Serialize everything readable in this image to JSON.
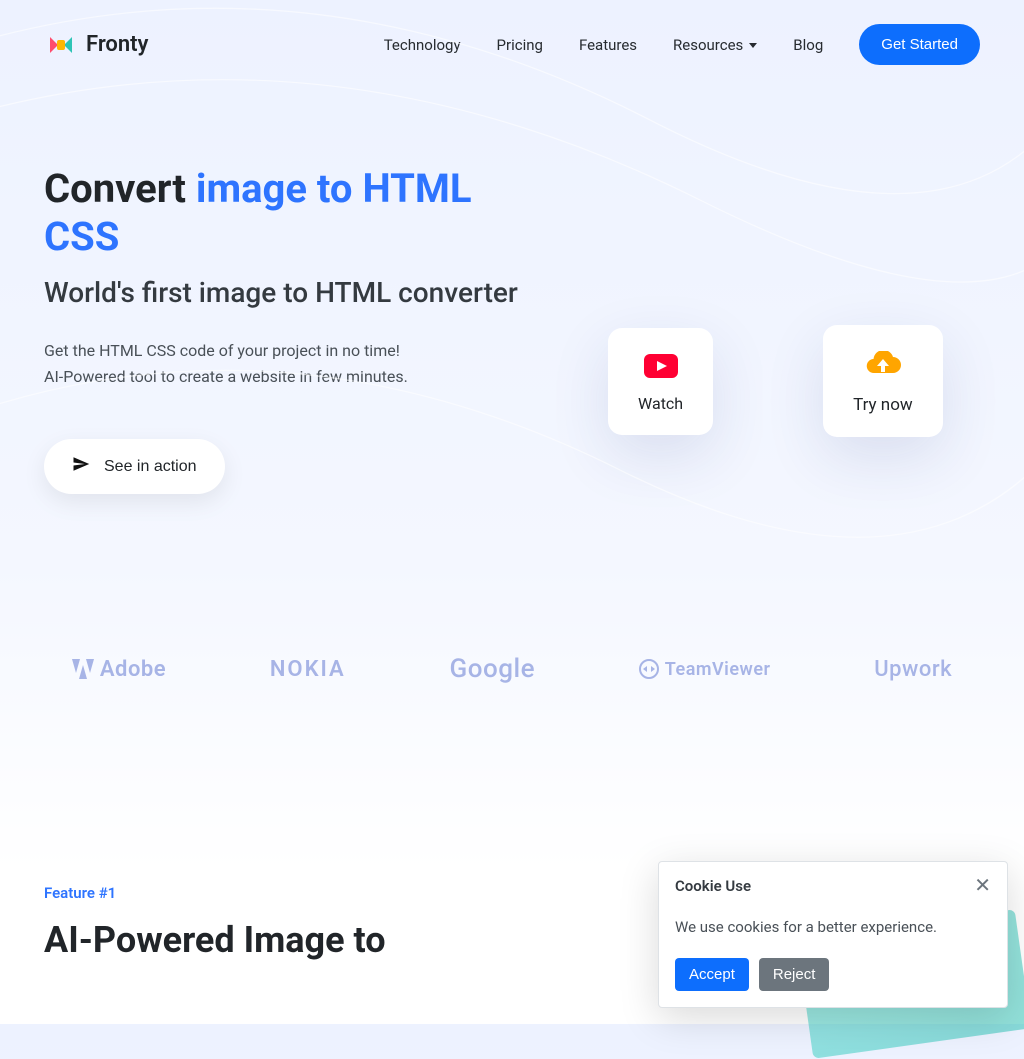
{
  "brand": {
    "name": "Fronty"
  },
  "nav": {
    "items": [
      "Technology",
      "Pricing",
      "Features",
      "Resources",
      "Blog"
    ],
    "cta": "Get Started"
  },
  "hero": {
    "title_prefix": "Convert ",
    "title_highlight": "image to HTML CSS",
    "subtitle": "World's first image to HTML converter",
    "desc_line1": "Get the HTML CSS code of your project in no time!",
    "desc_line2": "AI-Powered tool to create a website in few minutes.",
    "action_button": "See in action",
    "card_watch": "Watch",
    "card_try": "Try now"
  },
  "logos": [
    "Adobe",
    "NOKIA",
    "Google",
    "TeamViewer",
    "Upwork"
  ],
  "feature": {
    "tag": "Feature #1",
    "title": "AI-Powered Image to"
  },
  "cookie": {
    "title": "Cookie Use",
    "text": "We use cookies for a better experience.",
    "accept": "Accept",
    "reject": "Reject"
  }
}
